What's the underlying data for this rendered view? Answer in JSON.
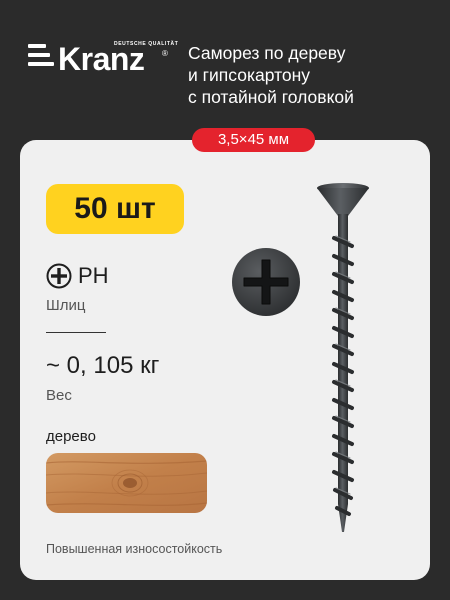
{
  "brand": {
    "name": "Kranz",
    "tagline": "DEUTSCHE QUALITÄT",
    "registered": "®"
  },
  "product": {
    "title_lines": [
      "Саморез по дереву",
      "и гипсокартону",
      "с потайной головкой"
    ],
    "size": "3,5×45 мм",
    "quantity": "50 шт",
    "slot_value": "PH",
    "slot_label": "Шлиц",
    "weight_value": "~ 0, 105 кг",
    "weight_label": "Вес",
    "material": "дерево",
    "footnote": "Повышенная износостойкость"
  },
  "colors": {
    "background": "#2b2b2b",
    "card": "#f0f0f0",
    "accent_red": "#e4232d",
    "accent_yellow": "#ffd21f",
    "screw": "#3a3d40",
    "wood": "#c8874f"
  },
  "icons": [
    "phillips-slot-icon",
    "screw-head-icon",
    "screw-image",
    "wood-swatch"
  ]
}
